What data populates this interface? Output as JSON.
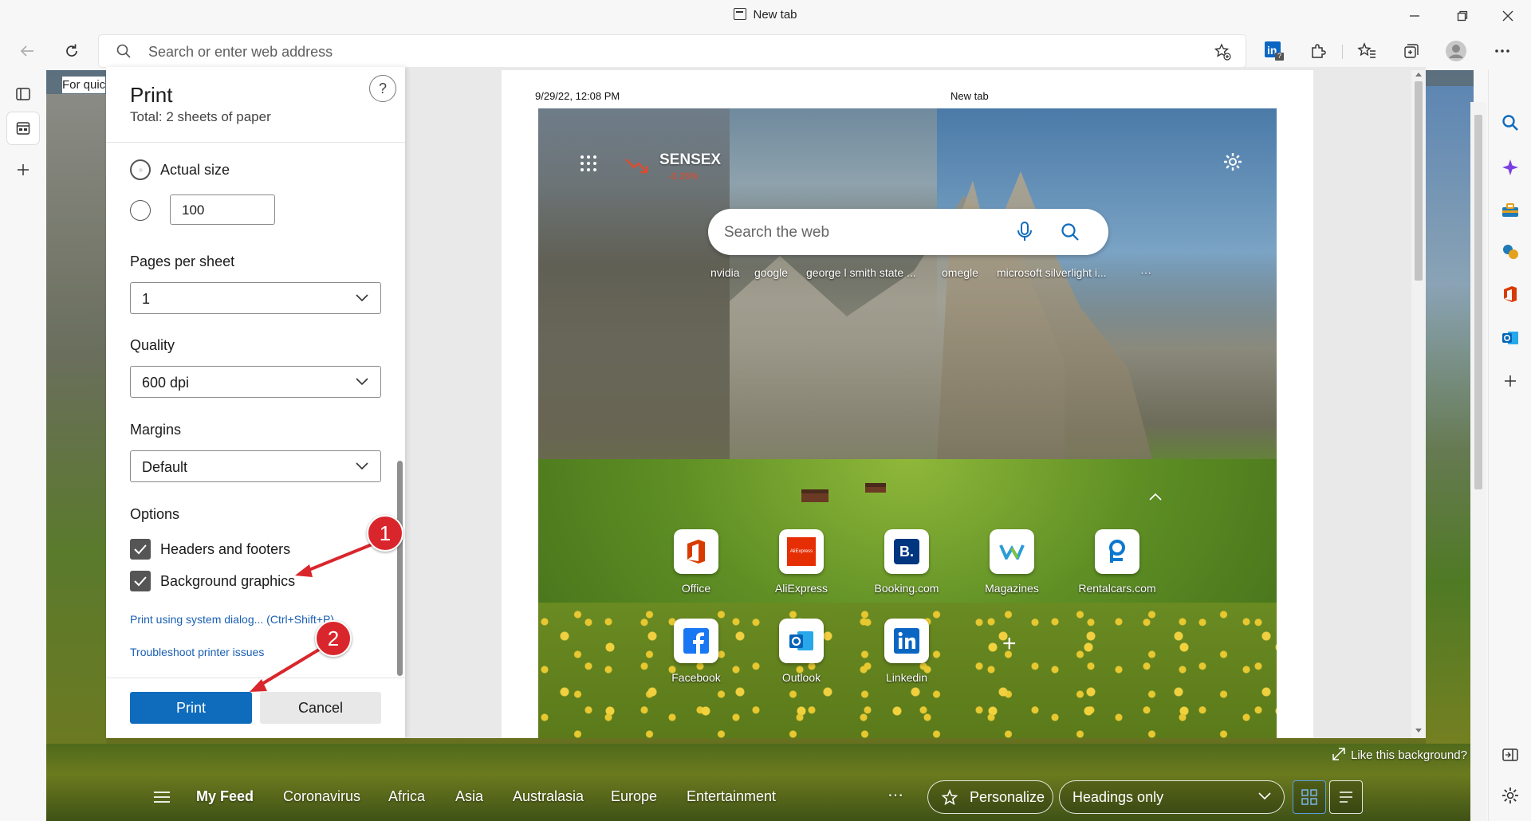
{
  "window": {
    "title": "New tab"
  },
  "toolbar": {
    "address_placeholder": "Search or enter web address",
    "extension_badge": "?"
  },
  "page": {
    "favorites_hint": "For quic",
    "like_background": "Like this background?",
    "nav": {
      "items": [
        "My Feed",
        "Coronavirus",
        "Africa",
        "Asia",
        "Australasia",
        "Europe",
        "Entertainment"
      ],
      "more": "⋯",
      "personalize_label": "Personalize",
      "view_select": "Headings only"
    }
  },
  "print_dialog": {
    "title": "Print",
    "subtitle": "Total: 2 sheets of paper",
    "help": "?",
    "scale": {
      "actual_size_label": "Actual size",
      "custom_value": "100"
    },
    "pages_per_sheet": {
      "label": "Pages per sheet",
      "value": "1"
    },
    "quality": {
      "label": "Quality",
      "value": "600 dpi"
    },
    "margins": {
      "label": "Margins",
      "value": "Default"
    },
    "options": {
      "label": "Options",
      "headers_footers": {
        "label": "Headers and footers",
        "checked": true
      },
      "background_graphics": {
        "label": "Background graphics",
        "checked": true
      }
    },
    "links": {
      "system_dialog": "Print using system dialog... (Ctrl+Shift+P)",
      "troubleshoot": "Troubleshoot printer issues"
    },
    "buttons": {
      "print": "Print",
      "cancel": "Cancel"
    }
  },
  "preview": {
    "header_date": "9/29/22, 12:08 PM",
    "header_title": "New tab",
    "newtab": {
      "ticker_name": "SENSEX",
      "ticker_change": "-0.26%",
      "search_placeholder": "Search the web",
      "trending": [
        "nvidia",
        "google",
        "george l smith state ...",
        "omegle",
        "microsoft silverlight i..."
      ],
      "trending_more": "⋯",
      "tiles_row1": [
        "Office",
        "AliExpress",
        "Booking.com",
        "Magazines",
        "Rentalcars.com"
      ],
      "tiles_row2": [
        "Facebook",
        "Outlook",
        "Linkedin"
      ],
      "aliexpress_text": "AliExpress",
      "booking_text": "B.",
      "add_tile": "+"
    }
  },
  "annotations": [
    "1",
    "2"
  ],
  "colors": {
    "accent": "#0f6cbd",
    "annotation": "#d9262c",
    "link": "#1a5fb4"
  }
}
